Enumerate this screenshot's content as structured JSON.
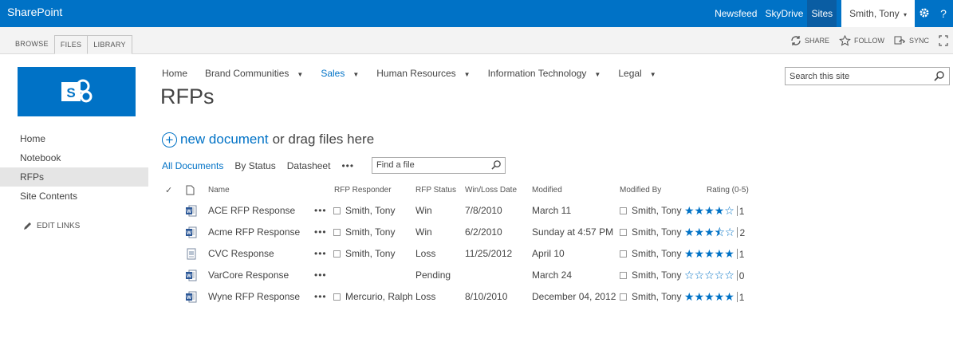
{
  "suite": {
    "brand": "SharePoint",
    "links": [
      "Newsfeed",
      "SkyDrive",
      "Sites"
    ],
    "user": "Smith, Tony",
    "user_caret": "▾",
    "help": "?"
  },
  "ribbon": {
    "tabs": [
      "BROWSE",
      "FILES",
      "LIBRARY"
    ],
    "share": "SHARE",
    "follow": "FOLLOW",
    "sync": "SYNC"
  },
  "leftnav": {
    "items": [
      "Home",
      "Notebook",
      "RFPs",
      "Site Contents"
    ],
    "edit_links": "EDIT LINKS"
  },
  "topnav": {
    "items": [
      "Home",
      "Brand Communities",
      "Sales",
      "Human Resources",
      "Information Technology",
      "Legal"
    ]
  },
  "page": {
    "title": "RFPs",
    "search_placeholder": "Search this site"
  },
  "newdoc": {
    "new_label": "new document",
    "drag_label": "or drag files here"
  },
  "views": {
    "items": [
      "All Documents",
      "By Status",
      "Datasheet"
    ],
    "more": "•••",
    "find_placeholder": "Find a file"
  },
  "table": {
    "columns": [
      "Name",
      "RFP Responder",
      "RFP Status",
      "Win/Loss Date",
      "Modified",
      "Modified By",
      "Rating (0-5)"
    ],
    "rows": [
      {
        "name": "ACE RFP Response",
        "dots": "•••",
        "responder": "Smith, Tony",
        "status": "Win",
        "date": "7/8/2010",
        "modified": "March 11",
        "modified_by": "Smith, Tony",
        "stars": "★★★★☆",
        "count": "1",
        "icon": "word-doc-icon"
      },
      {
        "name": "Acme RFP Response",
        "dots": "•••",
        "responder": "Smith, Tony",
        "status": "Win",
        "date": "6/2/2010",
        "modified": "Sunday at 4:57 PM",
        "modified_by": "Smith, Tony",
        "stars": "★★★⯪☆",
        "count": "2",
        "icon": "word-doc-icon"
      },
      {
        "name": "CVC Response",
        "dots": "•••",
        "responder": "Smith, Tony",
        "status": "Loss",
        "date": "11/25/2012",
        "modified": "April 10",
        "modified_by": "Smith, Tony",
        "stars": "★★★★★",
        "count": "1",
        "icon": "generic-doc-icon"
      },
      {
        "name": "VarCore Response",
        "dots": "•••",
        "responder": "",
        "status": "Pending",
        "date": "",
        "modified": "March 24",
        "modified_by": "Smith, Tony",
        "stars": "☆☆☆☆☆",
        "count": "0",
        "icon": "word-doc-icon"
      },
      {
        "name": "Wyne RFP Response",
        "dots": "•••",
        "responder": "Mercurio, Ralph",
        "status": "Loss",
        "date": "8/10/2010",
        "modified": "December 04, 2012",
        "modified_by": "Smith, Tony",
        "stars": "★★★★★",
        "count": "1",
        "icon": "word-doc-icon"
      }
    ]
  },
  "colors": {
    "accent": "#0072c6",
    "suitebar": "#0072c6",
    "ribbon": "#f3f3f3"
  }
}
